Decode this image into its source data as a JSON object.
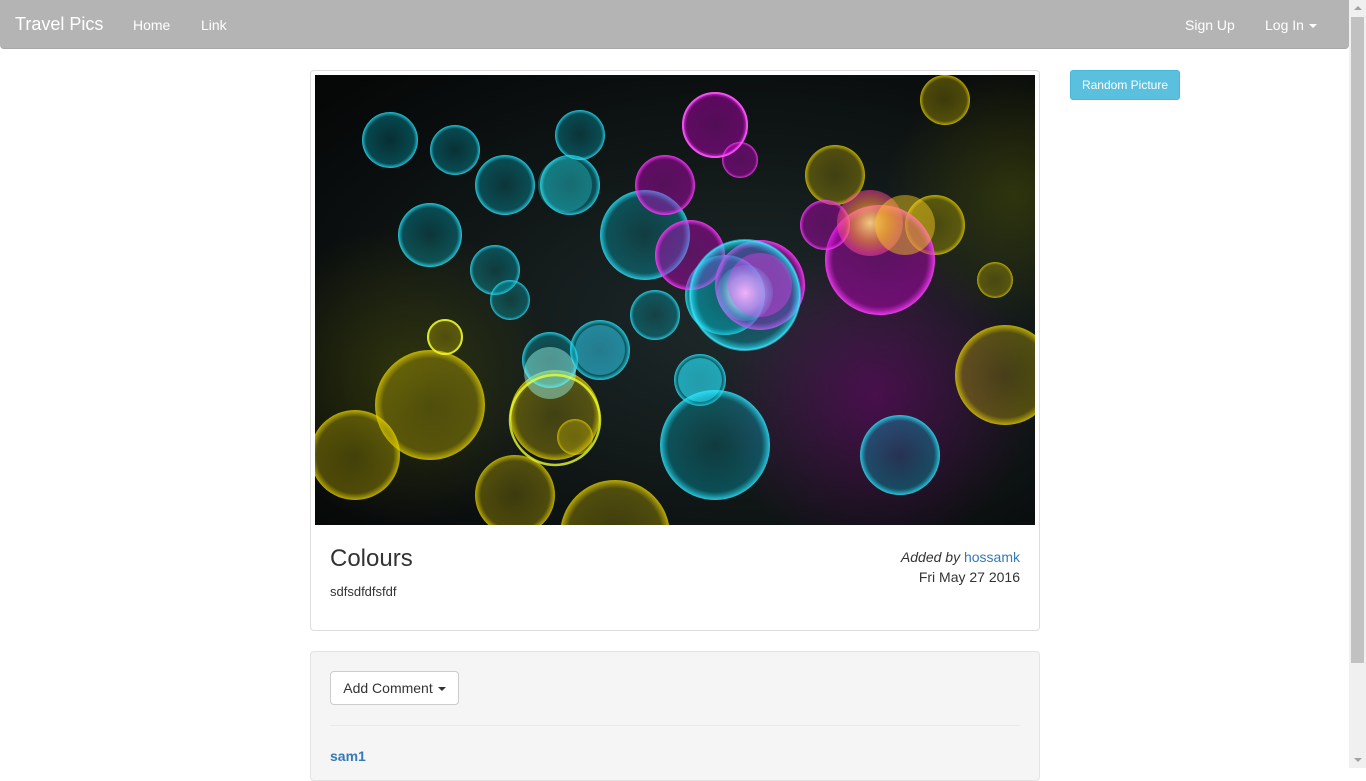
{
  "navbar": {
    "brand": "Travel Pics",
    "links": [
      {
        "label": "Home"
      },
      {
        "label": "Link"
      }
    ],
    "right_links": [
      {
        "label": "Sign Up"
      },
      {
        "label": "Log In"
      }
    ]
  },
  "picture": {
    "title": "Colours",
    "description": "sdfsdfdfsfdf",
    "added_by_label": "Added",
    "by_label": "by",
    "author": "hossamk",
    "date": "Fri May 27 2016",
    "image_icon": "bokeh-photo"
  },
  "sidebar": {
    "random_button": "Random Picture"
  },
  "comments": {
    "add_button": "Add Comment",
    "items": [
      {
        "author": "sam1"
      }
    ]
  },
  "colors": {
    "navbar": "#b4b4b4",
    "link": "#337ab7",
    "info_button": "#5bc0de"
  }
}
